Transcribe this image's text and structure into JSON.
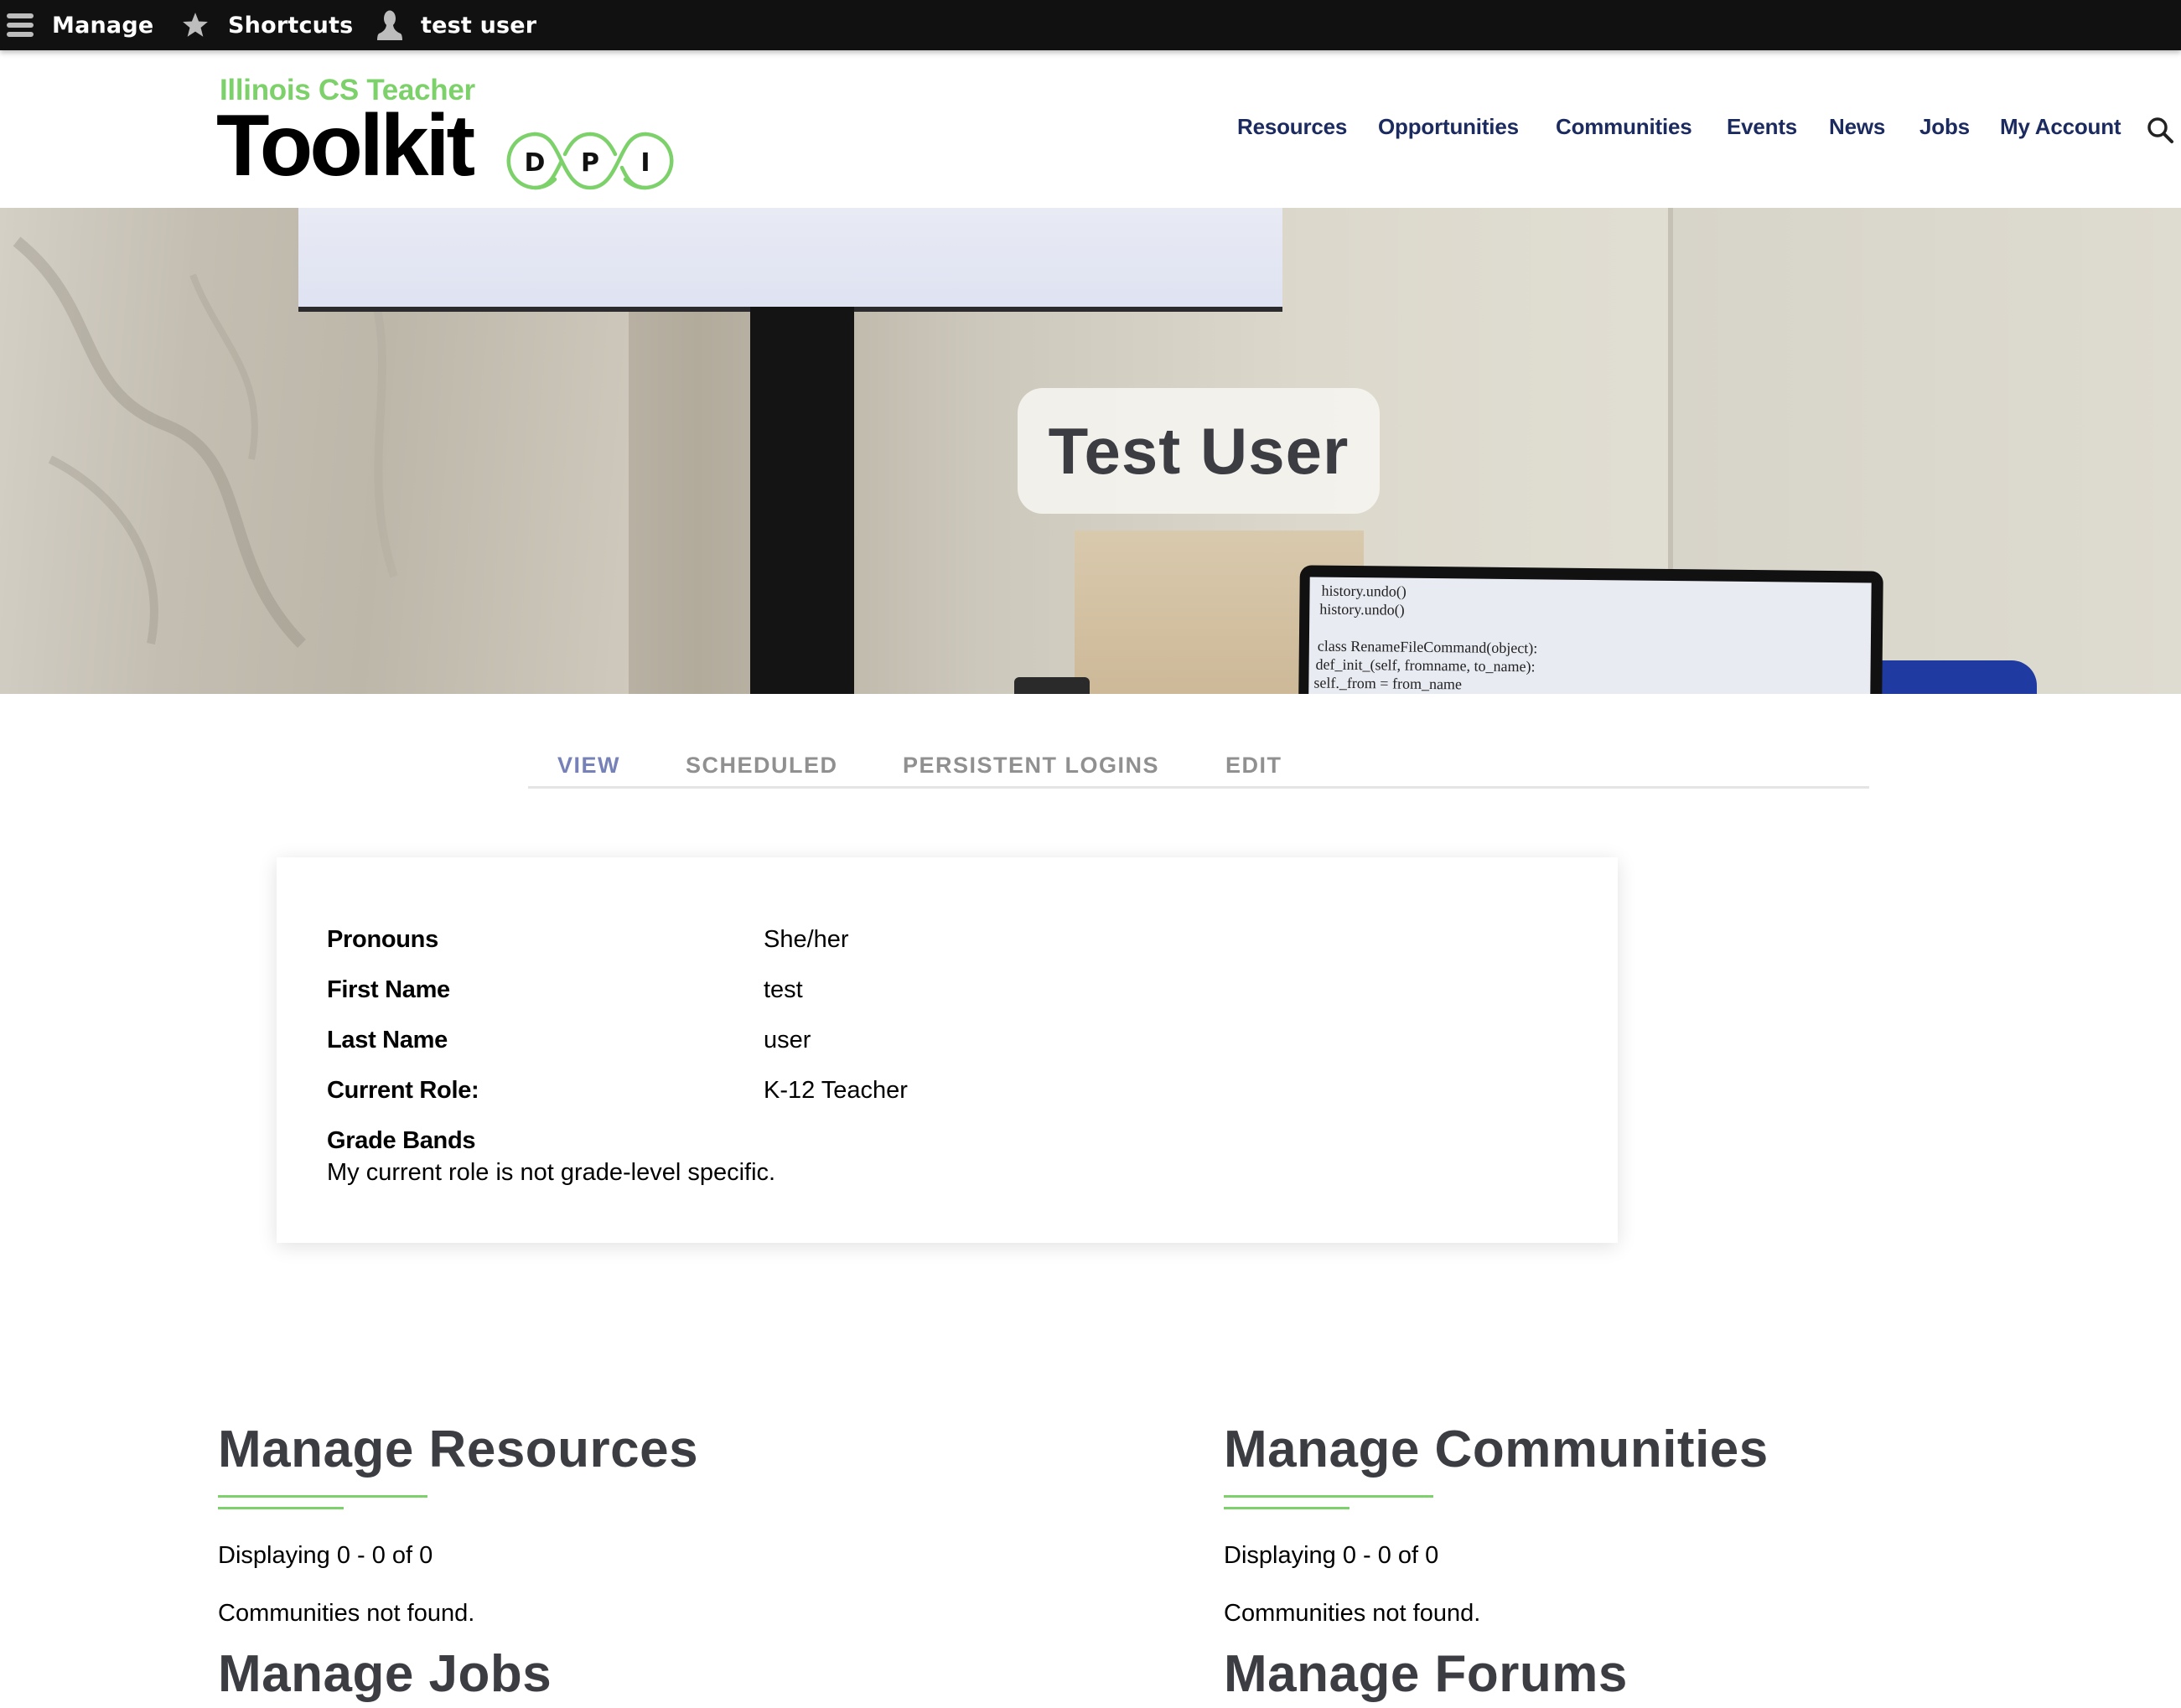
{
  "toolbar": {
    "manage_label": "Manage",
    "shortcuts_label": "Shortcuts",
    "user_label": "test user",
    "icons": {
      "menu": "hamburger-icon",
      "shortcuts": "star-icon",
      "user": "user-icon"
    }
  },
  "header": {
    "logo": {
      "subtitle": "Illinois CS Teacher",
      "title": "Toolkit",
      "badge_letters": [
        "D",
        "P",
        "I"
      ]
    },
    "nav": [
      {
        "label": "Resources"
      },
      {
        "label": "Opportunities"
      },
      {
        "label": "Communities"
      },
      {
        "label": "Events"
      },
      {
        "label": "News"
      },
      {
        "label": "Jobs"
      },
      {
        "label": "My Account"
      }
    ],
    "search_icon": "search-icon"
  },
  "hero": {
    "title": "Test User",
    "laptop_code": [
      "history.undo()",
      "history.undo()",
      "",
      "class RenameFileCommand(object):",
      "def_init_(self, fromname, to_name):",
      "self._from = from_name"
    ]
  },
  "tabs": [
    {
      "label": "VIEW",
      "active": true
    },
    {
      "label": "SCHEDULED",
      "active": false
    },
    {
      "label": "PERSISTENT LOGINS",
      "active": false
    },
    {
      "label": "EDIT",
      "active": false
    }
  ],
  "profile": {
    "fields": [
      {
        "label": "Pronouns",
        "value": "She/her"
      },
      {
        "label": "First Name",
        "value": "test"
      },
      {
        "label": "Last Name",
        "value": "user"
      },
      {
        "label": "Current Role:",
        "value": "K-12 Teacher"
      }
    ],
    "grade_bands": {
      "label": "Grade Bands",
      "value": "My current role is not grade-level specific."
    }
  },
  "sections": [
    {
      "title": "Manage Resources",
      "count_text": "Displaying 0 - 0 of 0",
      "empty_text": "Communities not found.",
      "next_title": "Manage Jobs"
    },
    {
      "title": "Manage Communities",
      "count_text": "Displaying 0 - 0 of 0",
      "empty_text": "Communities not found.",
      "next_title": "Manage Forums"
    }
  ],
  "colors": {
    "brand_green": "#7dd16a",
    "nav_navy": "#1b2a5f",
    "tab_active": "#7681b8",
    "tab_inactive": "#909090",
    "heading": "#3c3d42",
    "toolbar_bg": "#111111"
  }
}
